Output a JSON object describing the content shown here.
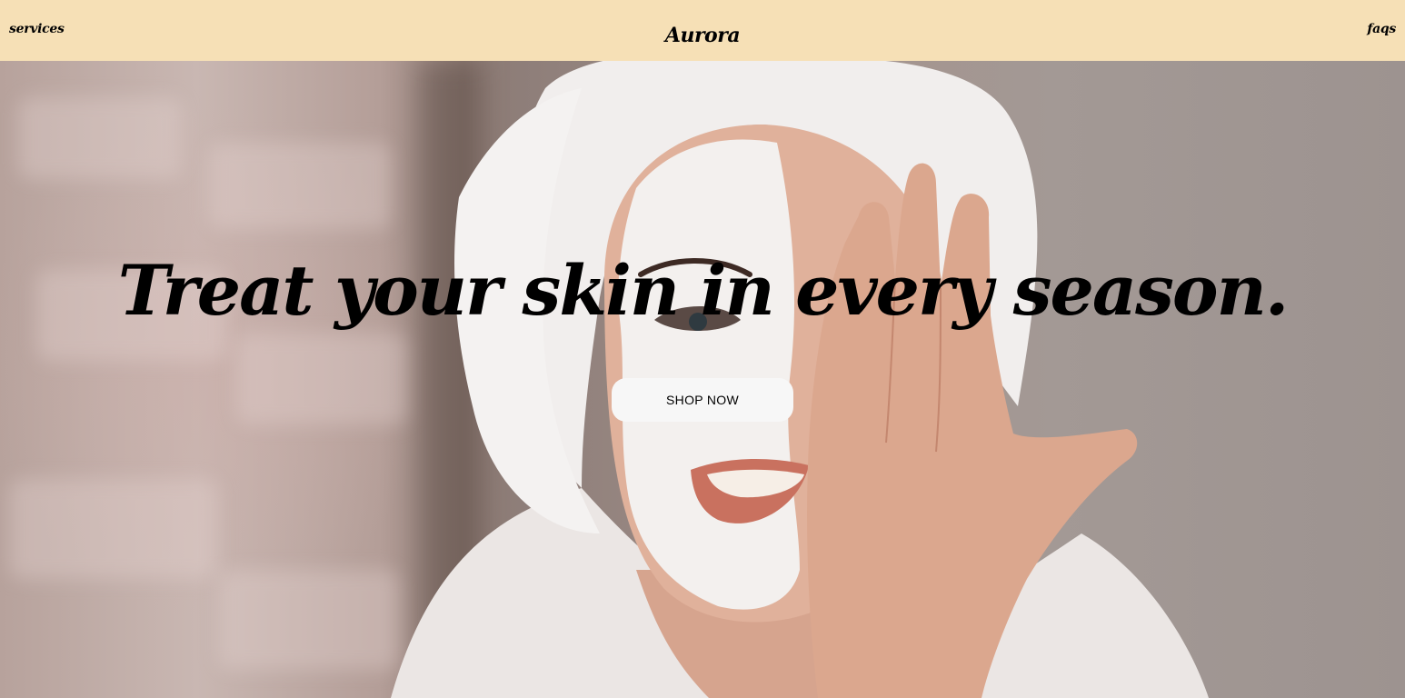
{
  "header": {
    "left_link": "services",
    "brand": "Aurora",
    "right_link": "faqs"
  },
  "hero": {
    "headline": "Treat your skin in every season.",
    "cta_label": "SHOP NOW"
  },
  "colors": {
    "header_background": "#f6e0b6",
    "button_background": "#f7f7f7",
    "text": "#000000"
  }
}
